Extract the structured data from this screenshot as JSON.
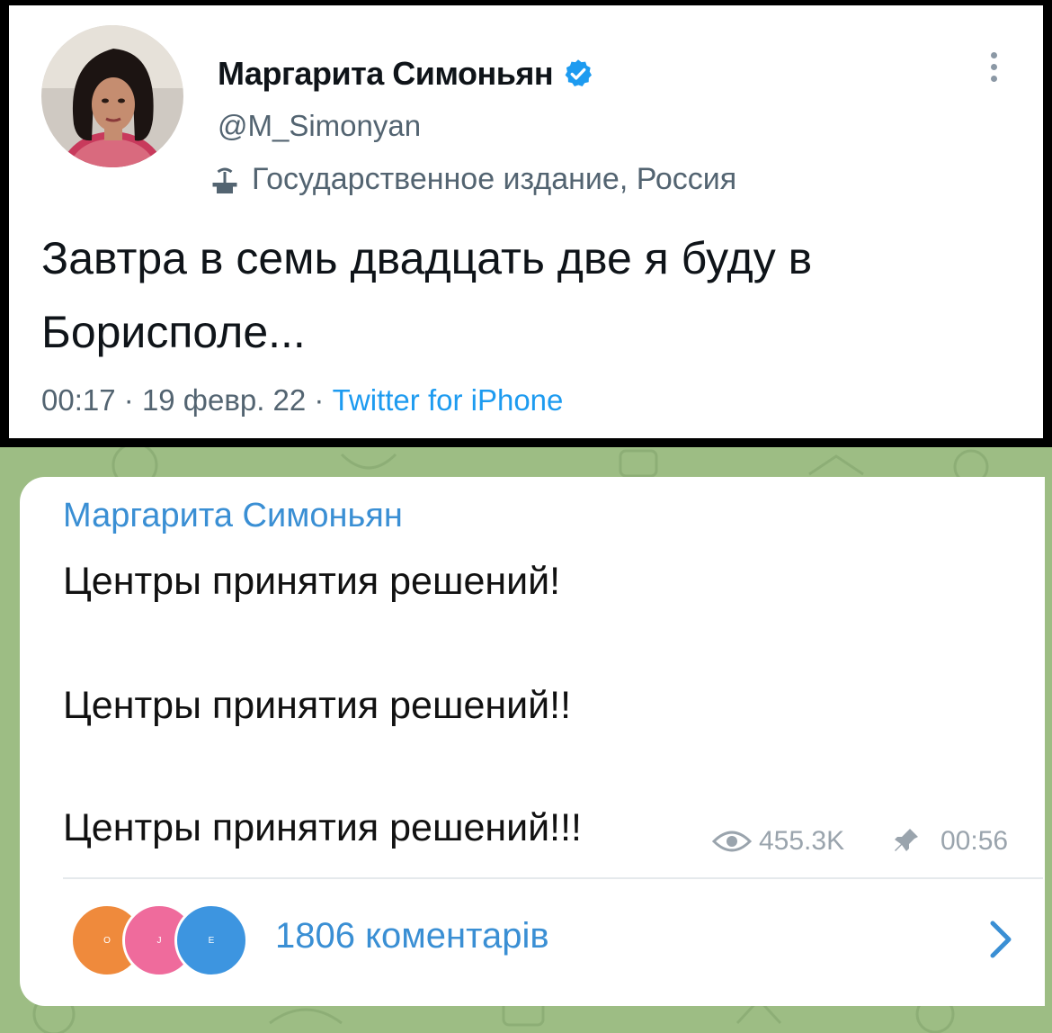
{
  "tweet": {
    "display_name": "Маргарита Симоньян",
    "handle": "@M_Simonyan",
    "label": "Государственное издание, Россия",
    "text": "Завтра в семь двадцать две я буду в Борисполе...",
    "time": "00:17",
    "date": "19 февр. 22",
    "source": "Twitter for iPhone",
    "icons": {
      "verified": "verified-badge-icon",
      "more": "more-options-icon",
      "label": "state-media-podium-icon"
    },
    "colors": {
      "accent": "#1d9bf0",
      "text": "#0f1419",
      "muted": "#536471"
    }
  },
  "telegram": {
    "author": "Маргарита Симоньян",
    "lines": [
      "Центры принятия решений!",
      "Центры принятия решений!!",
      "Центры принятия решений!!!"
    ],
    "views": "455.3K",
    "time": "00:56",
    "comments_label": "1806 коментарів",
    "commenter_avatars": [
      {
        "letter": "O",
        "color": "#ef8a3c"
      },
      {
        "letter": "J",
        "color": "#ef6b9c"
      },
      {
        "letter": "E",
        "color": "#3d95e0"
      }
    ],
    "icons": {
      "views": "eye-icon",
      "pin": "pin-icon",
      "open": "chevron-right-icon"
    },
    "colors": {
      "accent": "#3a8fd4",
      "background": "#9dbd84",
      "muted": "#9aa4ad"
    }
  }
}
